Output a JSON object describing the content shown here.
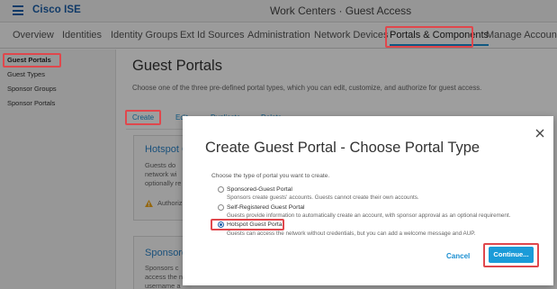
{
  "header": {
    "brand": "Cisco ISE",
    "title": "Work Centers · Guest Access"
  },
  "nav": {
    "tabs": [
      {
        "label": "Overview"
      },
      {
        "label": "Identities"
      },
      {
        "label": "Identity Groups"
      },
      {
        "label": "Ext Id Sources"
      },
      {
        "label": "Administration"
      },
      {
        "label": "Network Devices"
      },
      {
        "label": "Portals & Components",
        "active": true
      },
      {
        "label": "Manage Accounts"
      }
    ]
  },
  "sidebar": {
    "items": [
      {
        "label": "Guest Portals",
        "active": true
      },
      {
        "label": "Guest Types"
      },
      {
        "label": "Sponsor Groups"
      },
      {
        "label": "Sponsor Portals"
      }
    ]
  },
  "main": {
    "title": "Guest Portals",
    "description": "Choose one of the three pre-defined portal types, which you can edit, customize, and authorize for guest access.",
    "actions": {
      "create": "Create",
      "edit": "Edit",
      "duplicate": "Duplicate",
      "delete": "Delete"
    },
    "cards": [
      {
        "title": "Hotspot G",
        "lines": [
          "Guests do",
          "network wi",
          "optionally re"
        ],
        "status": "Authoriz"
      },
      {
        "title": "Sponsored",
        "lines": [
          "Sponsors c",
          "access the n",
          "username a"
        ]
      }
    ]
  },
  "dialog": {
    "title": "Create Guest Portal - Choose Portal Type",
    "prompt": "Choose the type of portal you want to create.",
    "options": [
      {
        "label": "Sponsored-Guest Portal",
        "description": "Sponsors create guests' accounts. Guests cannot create their own accounts.",
        "selected": false
      },
      {
        "label": "Self-Registered Guest Portal",
        "description": "Guests provide information to automatically create an account, with sponsor approval as an optional requirement.",
        "selected": false
      },
      {
        "label": "Hotspot Guest Portal",
        "description": "Guests can access the network without credentials, but you can add a welcome message and AUP.",
        "selected": true
      }
    ],
    "cancel_label": "Cancel",
    "continue_label": "Continue..."
  },
  "colors": {
    "brand": "#1b5ea8",
    "accent": "#1b9bd8",
    "highlight": "#e0474c"
  },
  "icons": {
    "menu": "hamburger-icon",
    "close": "close-icon",
    "warning": "warning-icon"
  }
}
